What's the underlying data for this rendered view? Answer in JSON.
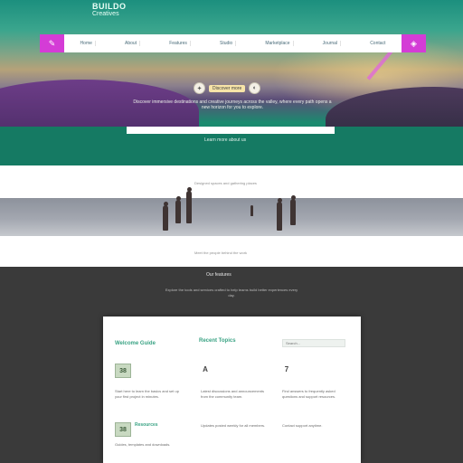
{
  "hero": {
    "brand": "BUILDO",
    "tagline": "Creatives",
    "nav_items": [
      "Home",
      "About",
      "Features",
      "Studio",
      "Marketplace",
      "Journal",
      "Contact"
    ],
    "badge_label": "Discover more",
    "description": "Discover immersive destinations and creative journeys across the valley, where every path opens a new horizon for you to explore.",
    "cta_link": "Learn more about us",
    "accent_color": "#d43cd6",
    "brand_color": "#157a63"
  },
  "showcase": {
    "caption_top": "Designed spaces and gathering places",
    "caption_bottom": "Meet the people behind the work"
  },
  "features": {
    "title": "Our features",
    "description": "Explore the tools and services crafted to help teams build better experiences every day.",
    "card": {
      "heading_left": "Welcome Guide",
      "heading_center": "Recent Topics",
      "search_placeholder": "Search...",
      "items": [
        {
          "icon": "38",
          "text": "Start here to learn the basics and set up your first project in minutes."
        },
        {
          "icon": "A",
          "text": "Latest discussions and announcements from the community team."
        },
        {
          "icon": "7",
          "text": "Find answers to frequently asked questions and support resources."
        }
      ],
      "bottom_item": {
        "icon": "38",
        "label": "Resources",
        "text": "Guides, templates and downloads."
      },
      "bottom_texts": [
        "Updates posted weekly for all members.",
        "Contact support anytime."
      ]
    }
  }
}
